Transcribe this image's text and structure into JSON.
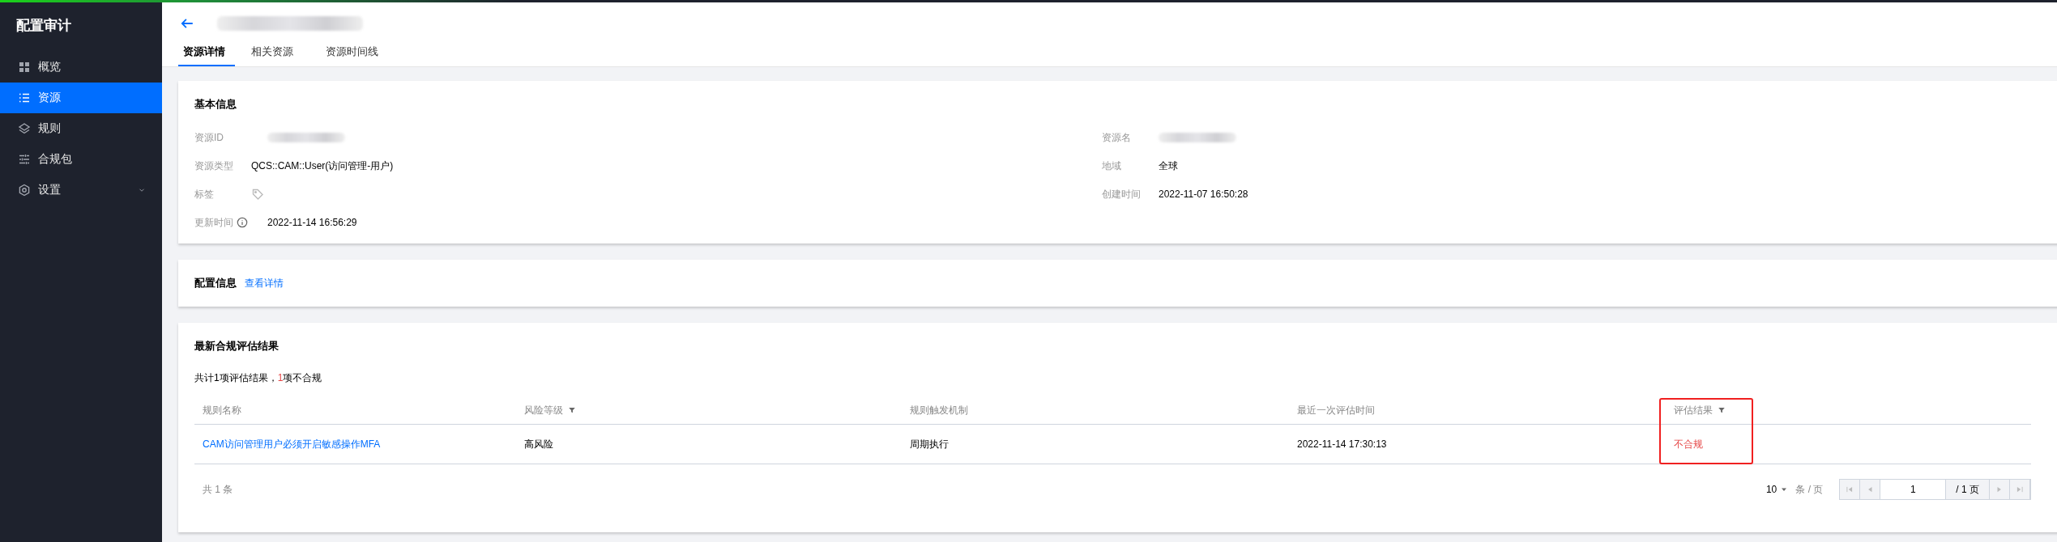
{
  "sidebar": {
    "title": "配置审计",
    "items": [
      {
        "label": "概览",
        "kind": "grid",
        "selected": false,
        "expandable": false
      },
      {
        "label": "资源",
        "kind": "list",
        "selected": true,
        "expandable": false
      },
      {
        "label": "规则",
        "kind": "layers",
        "selected": false,
        "expandable": false
      },
      {
        "label": "合规包",
        "kind": "sliders",
        "selected": false,
        "expandable": false
      },
      {
        "label": "设置",
        "kind": "settings",
        "selected": false,
        "expandable": true
      }
    ]
  },
  "header": {
    "tabs": [
      {
        "label": "资源详情",
        "selected": true
      },
      {
        "label": "相关资源",
        "selected": false
      },
      {
        "label": "资源时间线",
        "selected": false
      }
    ]
  },
  "basic_info": {
    "title": "基本信息",
    "columns": [
      [
        {
          "label": "资源ID",
          "kind": "redacted",
          "info": false
        },
        {
          "label": "资源类型",
          "kind": "text",
          "value": "QCS::CAM::User(访问管理-用户)",
          "info": false
        },
        {
          "label": "标签",
          "kind": "tag",
          "info": false
        },
        {
          "label": "更新时间",
          "kind": "text",
          "value": "2022-11-14 16:56:29",
          "info": true
        }
      ],
      [
        {
          "label": "资源名",
          "kind": "redacted",
          "info": false
        },
        {
          "label": "地域",
          "kind": "text",
          "value": "全球",
          "info": false
        },
        {
          "label": "创建时间",
          "kind": "text",
          "value": "2022-11-07 16:50:28",
          "info": false
        }
      ]
    ]
  },
  "config_info": {
    "title": "配置信息",
    "link": "查看详情"
  },
  "compliance": {
    "title": "最新合规评估结果",
    "summary": [
      {
        "text": "共计1项评估结果，",
        "emphasis": false
      },
      {
        "text": "1",
        "emphasis": true
      },
      {
        "text": "项不合规",
        "emphasis": false
      }
    ],
    "table": {
      "columns": [
        {
          "label": "规则名称",
          "filter": false,
          "highlighted": false
        },
        {
          "label": "风险等级",
          "filter": true,
          "highlighted": false
        },
        {
          "label": "规则触发机制",
          "filter": false,
          "highlighted": false
        },
        {
          "label": "最近一次评估时间",
          "filter": false,
          "highlighted": false
        },
        {
          "label": "评估结果",
          "filter": true,
          "highlighted": true
        }
      ],
      "rows": [
        {
          "cells": [
            {
              "text": "CAM访问管理用户必须开启敏感操作MFA",
              "kind": "link"
            },
            {
              "text": "高风险",
              "kind": "text"
            },
            {
              "text": "周期执行",
              "kind": "text"
            },
            {
              "text": "2022-11-14 17:30:13",
              "kind": "text"
            },
            {
              "text": "不合规",
              "kind": "danger"
            }
          ]
        }
      ]
    },
    "pagination": {
      "total": "共 1 条",
      "page_size": "10",
      "per_page_label": "条 / 页",
      "page": "1",
      "page_count": "/ 1 页"
    }
  }
}
